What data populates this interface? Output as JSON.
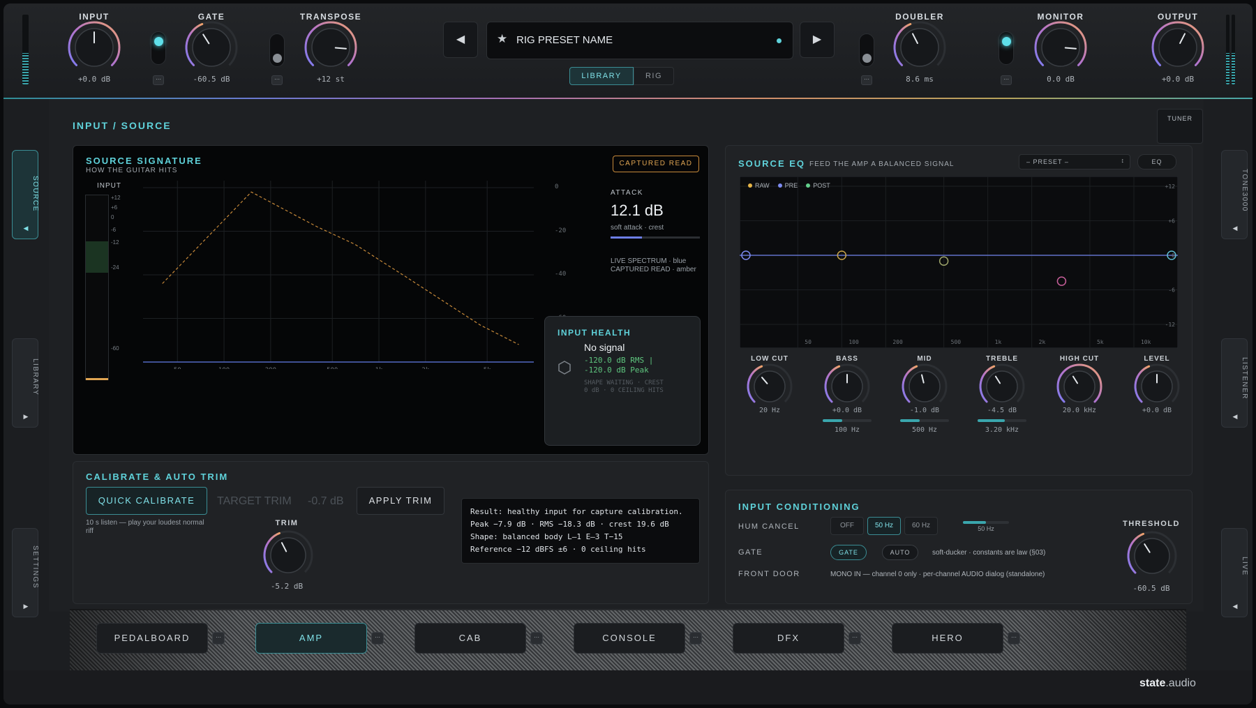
{
  "header": {
    "knobs": [
      {
        "id": "input",
        "label": "INPUT",
        "value": "+0.0 dB"
      },
      {
        "id": "gate",
        "label": "GATE",
        "value": "-60.5 dB"
      },
      {
        "id": "transpose",
        "label": "TRANSPOSE",
        "value": "+12 st"
      },
      {
        "id": "doubler",
        "label": "DOUBLER",
        "value": "8.6 ms"
      },
      {
        "id": "monitor",
        "label": "MONITOR",
        "value": "0.0 dB"
      },
      {
        "id": "output",
        "label": "OUTPUT",
        "value": "+0.0 dB"
      }
    ],
    "more_label": "⋯",
    "preset": {
      "name": "RIG PRESET NAME",
      "star": "★",
      "prev": "◀",
      "next": "▶"
    },
    "segment": {
      "library": "LIBRARY",
      "rig": "RIG",
      "active": "library"
    },
    "meters": {
      "input_level": 0.45,
      "output_level": 0.45
    },
    "toggles": {
      "gate_on": true,
      "transpose_on": false,
      "doubler_on": false,
      "monitor_on": true
    }
  },
  "sidebar_left": [
    {
      "label": "SOURCE",
      "arrow": "◀",
      "active": true
    },
    {
      "label": "LIBRARY",
      "arrow": "▶"
    },
    {
      "label": "SETTINGS",
      "arrow": "▶"
    }
  ],
  "sidebar_right": [
    {
      "label": "TONE3000",
      "arrow": "◀"
    },
    {
      "label": "LISTENER",
      "arrow": "◀"
    },
    {
      "label": "LIVE",
      "arrow": "◀"
    }
  ],
  "tuner": {
    "label": "TUNER"
  },
  "section": {
    "title": "INPUT / SOURCE"
  },
  "signature": {
    "title": "SOURCE SIGNATURE",
    "subtitle": "HOW THE GUITAR HITS",
    "badge": "CAPTURED READ",
    "meter_label": "INPUT",
    "meter_ticks": [
      "+12",
      "+6",
      "0",
      "-6",
      "-12",
      "-24",
      "-60"
    ],
    "db_ticks": [
      "0",
      "-20",
      "-40",
      "-60"
    ],
    "freq_ticks": [
      "50",
      "100",
      "200",
      "500",
      "1k",
      "2k",
      "5k"
    ],
    "attack_label": "ATTACK",
    "attack_value": "12.1 dB",
    "attack_desc": "soft attack · crest",
    "attack_level": 0.35,
    "legend_1": "LIVE SPECTRUM · blue",
    "legend_2": "CAPTURED READ · amber"
  },
  "health": {
    "title": "INPUT HEALTH",
    "status": "No signal",
    "rms": "-120.0 dB RMS |",
    "peak": "-120.0 dB Peak",
    "shape_1": "SHAPE WAITING · CREST",
    "shape_2": "0 dB · 0 CEILING HITS"
  },
  "calibrate": {
    "title": "CALIBRATE & AUTO TRIM",
    "quick": "QUICK CALIBRATE",
    "target_label": "TARGET TRIM",
    "target_value": "-0.7 dB",
    "apply": "APPLY TRIM",
    "hint": "10 s listen — play your loudest normal riff",
    "trim_label": "TRIM",
    "trim_value": "-5.2 dB",
    "result": [
      "Result: healthy input for capture calibration.",
      "Peak −7.9 dB · RMS −18.3 dB · crest 19.6 dB",
      "Shape: balanced body  L–1 E–3 T−15",
      "Reference −12 dBFS ±6 · 0 ceiling hits"
    ]
  },
  "eq": {
    "title": "SOURCE EQ",
    "subtitle": "FEED THE AMP A BALANCED SIGNAL",
    "preset": "– PRESET –",
    "eq_btn": "EQ",
    "legend": [
      {
        "name": "RAW",
        "color": "#e7b547"
      },
      {
        "name": "PRE",
        "color": "#7d8bf0"
      },
      {
        "name": "POST",
        "color": "#63d08c"
      }
    ],
    "db_ticks": [
      "+12",
      "+6",
      "0",
      "-6",
      "-12"
    ],
    "freq_ticks": [
      "50",
      "100",
      "200",
      "500",
      "1k",
      "2k",
      "5k",
      "10k"
    ],
    "knobs": [
      {
        "label": "LOW CUT",
        "value": "20 Hz",
        "color": "#6d737a"
      },
      {
        "label": "BASS",
        "value": "+0.0 dB",
        "freq": "100 Hz",
        "freq_level": 0.4
      },
      {
        "label": "MID",
        "value": "-1.0 dB",
        "freq": "500 Hz",
        "freq_level": 0.4
      },
      {
        "label": "TREBLE",
        "value": "-4.5 dB",
        "freq": "3.20 kHz",
        "freq_level": 0.55
      },
      {
        "label": "HIGH CUT",
        "value": "20.0 kHz"
      },
      {
        "label": "LEVEL",
        "value": "+0.0 dB"
      }
    ]
  },
  "conditioning": {
    "title": "INPUT CONDITIONING",
    "hum_label": "HUM CANCEL",
    "hum_options": [
      "OFF",
      "50 Hz",
      "60 Hz"
    ],
    "hum_active": "50 Hz",
    "hum_slider_value": "50 Hz",
    "hum_slider_level": 0.5,
    "gate_label": "GATE",
    "gate_btn": "GATE",
    "auto_btn": "AUTO",
    "gate_desc": "soft-ducker · constants are law (§03)",
    "front_label": "FRONT DOOR",
    "front_desc": "MONO IN — channel 0 only · per-channel AUDIO dialog (standalone)",
    "threshold_label": "THRESHOLD",
    "threshold_value": "-60.5 dB"
  },
  "tabs": [
    {
      "label": "PEDALBOARD"
    },
    {
      "label": "AMP",
      "active": true
    },
    {
      "label": "CAB"
    },
    {
      "label": "CONSOLE"
    },
    {
      "label": "DFX"
    },
    {
      "label": "HERO"
    }
  ],
  "brand": {
    "prefix": "state",
    "suffix": ".audio"
  }
}
